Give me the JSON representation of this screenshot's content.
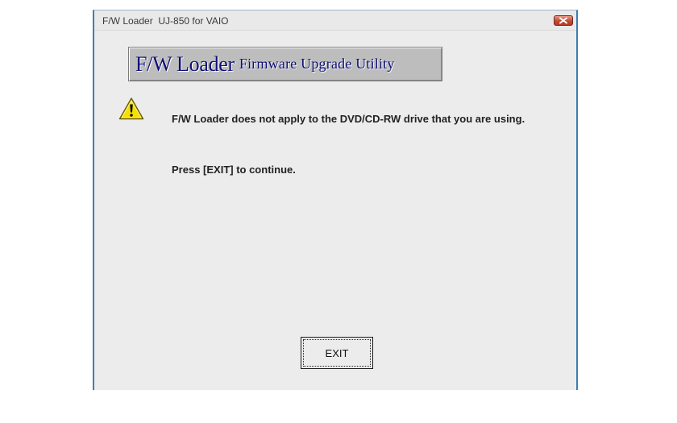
{
  "window": {
    "title": "F/W Loader  UJ-850 for VAIO"
  },
  "banner": {
    "main": "F/W Loader",
    "sub": "Firmware Upgrade Utility"
  },
  "message": {
    "icon": "warning-icon",
    "line": "F/W Loader does not apply to the DVD/CD-RW drive that you are using.",
    "continue": "Press [EXIT] to continue."
  },
  "buttons": {
    "exit_label": "EXIT"
  },
  "colors": {
    "window_border": "#3c7fb1",
    "client_bg": "#ececec",
    "banner_text": "#0e0e78",
    "close_red": "#c24b33",
    "warning_yellow": "#f5e000"
  }
}
